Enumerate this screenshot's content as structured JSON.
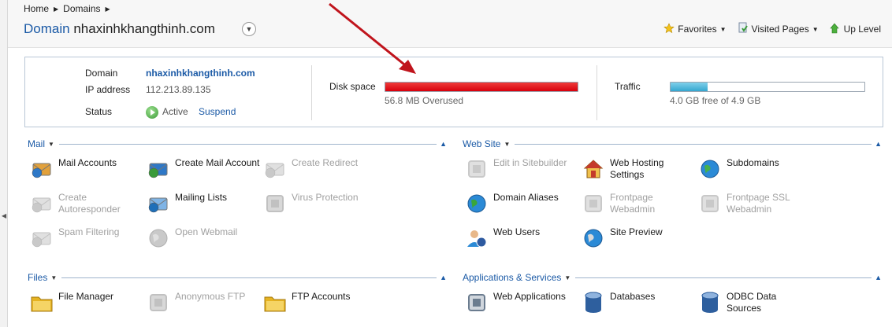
{
  "breadcrumb": [
    "Home",
    "Domains"
  ],
  "page": {
    "title_lead": "Domain",
    "title_name": "nhaxinhkhangthinh.com"
  },
  "toolbar": {
    "favorites": "Favorites",
    "visited": "Visited Pages",
    "up": "Up Level"
  },
  "info": {
    "domain_label": "Domain",
    "domain_value": "nhaxinhkhangthinh.com",
    "ip_label": "IP address",
    "ip_value": "112.213.89.135",
    "status_label": "Status",
    "status_value": "Active",
    "suspend_label": "Suspend",
    "disk_label": "Disk space",
    "disk_caption": "56.8 MB Overused",
    "disk_fraction": 1.0,
    "disk_color": "#d8000c",
    "traffic_label": "Traffic",
    "traffic_caption": "4.0 GB free of 4.9 GB",
    "traffic_fraction": 0.19,
    "traffic_color": "#35a6cf"
  },
  "sections": {
    "mail": "Mail",
    "website": "Web Site",
    "files": "Files",
    "apps": "Applications & Services"
  },
  "mail_tools": [
    {
      "label": "Mail Accounts",
      "icon": "mail-accounts-icon",
      "enabled": true
    },
    {
      "label": "Create Mail Account",
      "icon": "create-mail-account-icon",
      "enabled": true
    },
    {
      "label": "Create Redirect",
      "icon": "create-redirect-icon",
      "enabled": false
    },
    {
      "label": "Create Autoresponder",
      "icon": "autoresponder-icon",
      "enabled": false
    },
    {
      "label": "Mailing Lists",
      "icon": "mailing-lists-icon",
      "enabled": true
    },
    {
      "label": "Virus Protection",
      "icon": "virus-protection-icon",
      "enabled": false
    },
    {
      "label": "Spam Filtering",
      "icon": "spam-filtering-icon",
      "enabled": false
    },
    {
      "label": "Open Webmail",
      "icon": "webmail-icon",
      "enabled": false
    }
  ],
  "web_tools": [
    {
      "label": "Edit in Sitebuilder",
      "icon": "sitebuilder-icon",
      "enabled": false
    },
    {
      "label": "Web Hosting Settings",
      "icon": "hosting-settings-icon",
      "enabled": true
    },
    {
      "label": "Subdomains",
      "icon": "subdomains-icon",
      "enabled": true
    },
    {
      "label": "Domain Aliases",
      "icon": "domain-aliases-icon",
      "enabled": true
    },
    {
      "label": "Frontpage Webadmin",
      "icon": "frontpage-icon",
      "enabled": false
    },
    {
      "label": "Frontpage SSL Webadmin",
      "icon": "frontpage-ssl-icon",
      "enabled": false
    },
    {
      "label": "Web Users",
      "icon": "web-users-icon",
      "enabled": true
    },
    {
      "label": "Site Preview",
      "icon": "site-preview-icon",
      "enabled": true
    }
  ],
  "file_tools": [
    {
      "label": "File Manager",
      "icon": "file-manager-icon",
      "enabled": true
    },
    {
      "label": "Anonymous FTP",
      "icon": "anonymous-ftp-icon",
      "enabled": false
    },
    {
      "label": "FTP Accounts",
      "icon": "ftp-accounts-icon",
      "enabled": true
    }
  ],
  "app_tools": [
    {
      "label": "Web Applications",
      "icon": "web-applications-icon",
      "enabled": true
    },
    {
      "label": "Databases",
      "icon": "databases-icon",
      "enabled": true
    },
    {
      "label": "ODBC Data Sources",
      "icon": "odbc-icon",
      "enabled": true
    }
  ]
}
